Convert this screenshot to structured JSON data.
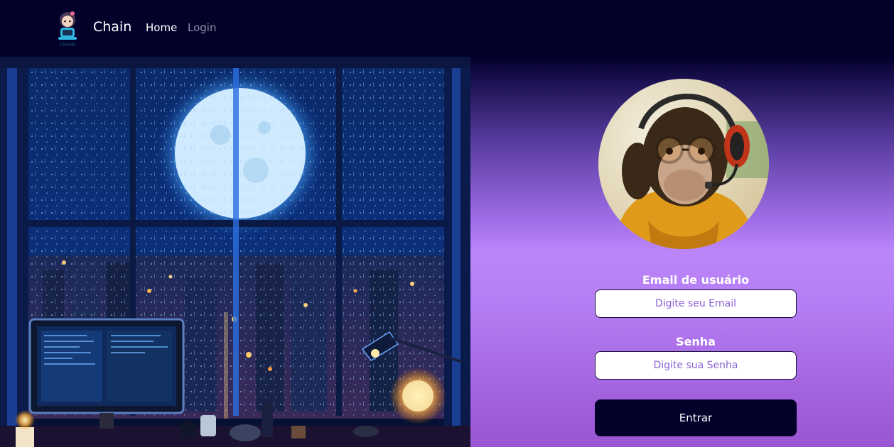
{
  "navbar": {
    "brand": "Chain",
    "logo_caption": "CHAIN",
    "links": [
      {
        "label": "Home",
        "active": true
      },
      {
        "label": "Login",
        "active": false
      }
    ]
  },
  "hero_image": {
    "icon": "rainy-night-desk-illustration"
  },
  "avatar": {
    "icon": "chimpanzee-headphones-avatar"
  },
  "form": {
    "email_label": "Email de usuário",
    "email_placeholder": "Digite seu Email",
    "password_label": "Senha",
    "password_placeholder": "Digite sua Senha",
    "submit_label": "Entrar"
  },
  "colors": {
    "navbar_bg": "#03002a",
    "panel_accent": "#bc86fb",
    "button_bg": "#03002a",
    "placeholder": "#8a62d6"
  }
}
